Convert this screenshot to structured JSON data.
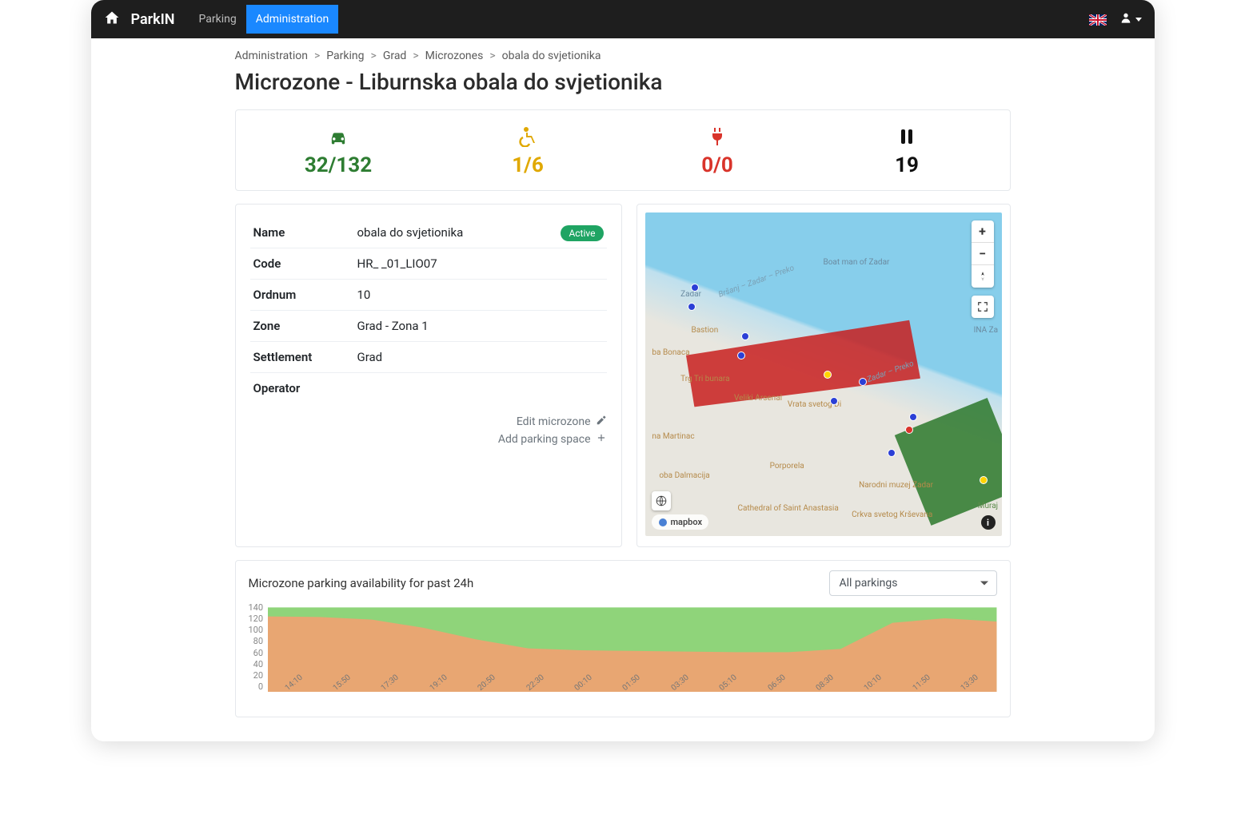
{
  "nav": {
    "brand": "ParkIN",
    "links": [
      "Parking",
      "Administration"
    ],
    "activeIndex": 1
  },
  "breadcrumb": {
    "items": [
      "Administration",
      "Parking",
      "Grad",
      "Microzones",
      "obala do svjetionika"
    ]
  },
  "page": {
    "title": "Microzone - Liburnska obala do svjetionika"
  },
  "stats": {
    "car": "32/132",
    "wheelchair": "1/6",
    "ev": "0/0",
    "barrier": "19"
  },
  "info": {
    "rows": [
      {
        "label": "Name",
        "value": "obala do svjetionika"
      },
      {
        "label": "Code",
        "value": "HR_   _01_LIO07"
      },
      {
        "label": "Ordnum",
        "value": "10"
      },
      {
        "label": "Zone",
        "value": "Grad        - Zona 1"
      },
      {
        "label": "Settlement",
        "value": "Grad"
      },
      {
        "label": "Operator",
        "value": ""
      }
    ],
    "status": "Active",
    "actions": {
      "edit": "Edit microzone",
      "add": "Add parking space"
    }
  },
  "map": {
    "attribution": "mapbox",
    "labels": {
      "boatman": "Boat man of Zadar",
      "zadar": "Zadar",
      "bonaca": "ba Bonaca",
      "bastion": "Bastion",
      "tribunara": "Trg Tri bunara",
      "arsenal": "Veliki Arsenal",
      "vrata": "Vrata svetog Di",
      "martinac": "na Martinac",
      "dalmacija": "oba Dalmacija",
      "porporela": "Porporela",
      "cathedral": "Cathedral of Saint Anastasia",
      "muzej": "Narodni muzej Zadar",
      "crkva": "Crkva svetog Krševana",
      "muraj": "Muraj",
      "ina": "INA Za",
      "preko": "Zadar – Preko",
      "brsanj": "Bršanj – Zadar – Preko"
    }
  },
  "chart": {
    "title": "Microzone parking availability for past 24h",
    "filter": "All parkings"
  },
  "chart_data": {
    "type": "area",
    "ylabel": "",
    "xlabel": "",
    "ylim": [
      0,
      140
    ],
    "yticks": [
      0,
      20,
      40,
      60,
      80,
      100,
      120,
      140
    ],
    "categories": [
      "14:10",
      "15:50",
      "17:30",
      "19:10",
      "20:50",
      "22:30",
      "00:10",
      "01:50",
      "03:30",
      "05:10",
      "06:50",
      "08:30",
      "10:10",
      "11:50",
      "13:30"
    ],
    "series": [
      {
        "name": "total_capacity",
        "color": "#8fd47a",
        "values": [
          132,
          132,
          132,
          132,
          132,
          132,
          132,
          132,
          132,
          132,
          132,
          132,
          132,
          132,
          132
        ]
      },
      {
        "name": "occupied",
        "color": "#e8a672",
        "values": [
          118,
          117,
          113,
          100,
          82,
          68,
          65,
          64,
          63,
          62,
          62,
          67,
          108,
          115,
          110
        ]
      }
    ]
  }
}
